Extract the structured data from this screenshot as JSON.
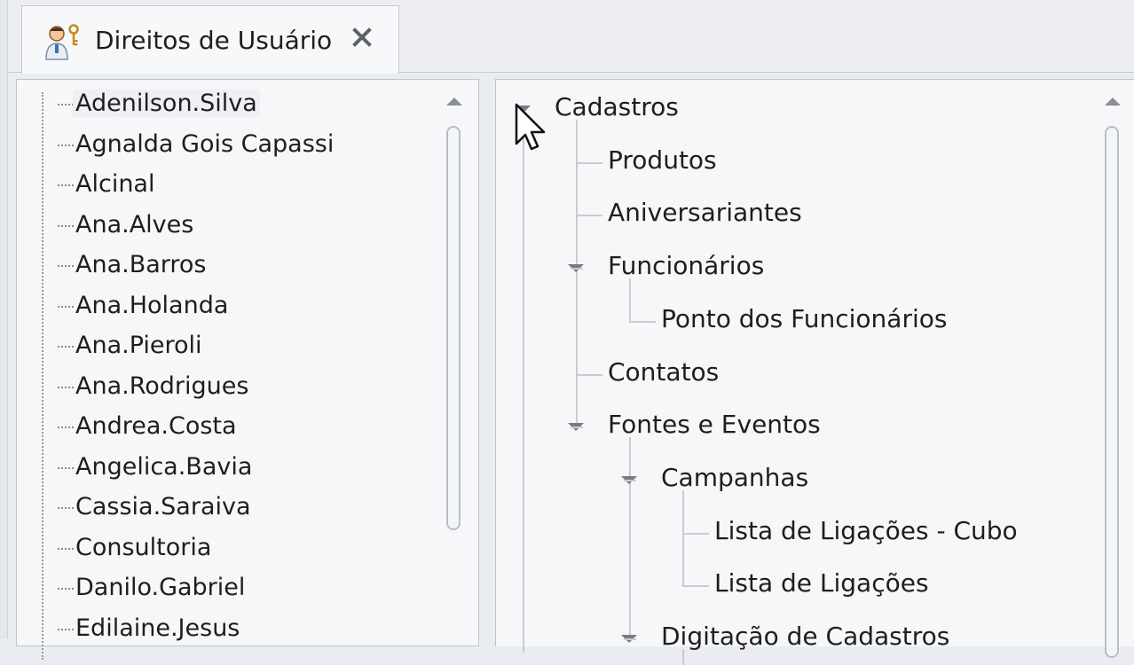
{
  "tab": {
    "title": "Direitos de Usuário",
    "icon": "user-key-icon",
    "close_icon": "close-icon"
  },
  "users": {
    "selected": "Adenilson.Silva",
    "items": [
      "Adenilson.Silva",
      "Agnalda Gois Capassi",
      "Alcinal",
      "Ana.Alves",
      "Ana.Barros",
      "Ana.Holanda",
      "Ana.Pieroli",
      "Ana.Rodrigues",
      "Andrea.Costa",
      "Angelica.Bavia",
      "Cassia.Saraiva",
      "Consultoria",
      "Danilo.Gabriel",
      "Edilaine.Jesus"
    ]
  },
  "tree": {
    "nodes": [
      {
        "label": "Cadastros",
        "level": 0,
        "expanded": true
      },
      {
        "label": "Produtos",
        "level": 1
      },
      {
        "label": "Aniversariantes",
        "level": 1
      },
      {
        "label": "Funcionários",
        "level": 1,
        "expanded": true
      },
      {
        "label": "Ponto dos Funcionários",
        "level": 2
      },
      {
        "label": "Contatos",
        "level": 1
      },
      {
        "label": "Fontes e Eventos",
        "level": 1,
        "expanded": true
      },
      {
        "label": "Campanhas",
        "level": 2,
        "expanded": true
      },
      {
        "label": "Lista de Ligações - Cubo",
        "level": 3
      },
      {
        "label": "Lista de Ligações",
        "level": 3
      },
      {
        "label": "Digitação de Cadastros",
        "level": 2,
        "expanded": true
      }
    ]
  },
  "colors": {
    "background": "#e9ecf1",
    "panel": "#f6f7f9",
    "tree_line": "#c9cbd0",
    "text": "#1e1e1e"
  }
}
